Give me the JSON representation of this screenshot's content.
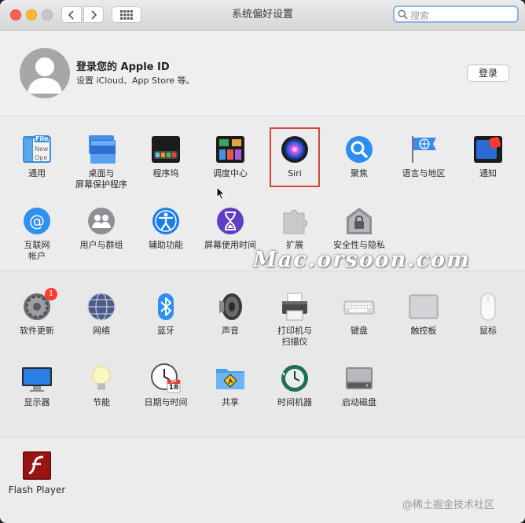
{
  "window": {
    "title": "系统偏好设置"
  },
  "search": {
    "placeholder": "搜索"
  },
  "account": {
    "title": "登录您的 Apple ID",
    "subtitle": "设置 iCloud、App Store 等。",
    "login_label": "登录"
  },
  "section1": [
    {
      "label": "通用",
      "icon": "general-icon"
    },
    {
      "label": "桌面与\n屏幕保护程序",
      "icon": "desktop-screensaver-icon"
    },
    {
      "label": "程序坞",
      "icon": "dock-icon"
    },
    {
      "label": "调度中心",
      "icon": "mission-control-icon"
    },
    {
      "label": "Siri",
      "icon": "siri-icon"
    },
    {
      "label": "聚焦",
      "icon": "spotlight-icon"
    },
    {
      "label": "语言与地区",
      "icon": "language-region-icon"
    },
    {
      "label": "通知",
      "icon": "notifications-icon"
    },
    {
      "label": "互联网\n帐户",
      "icon": "internet-accounts-icon"
    },
    {
      "label": "用户与群组",
      "icon": "users-groups-icon"
    },
    {
      "label": "辅助功能",
      "icon": "accessibility-icon"
    },
    {
      "label": "屏幕使用时间",
      "icon": "screen-time-icon"
    },
    {
      "label": "扩展",
      "icon": "extensions-icon"
    },
    {
      "label": "安全性与隐私",
      "icon": "security-privacy-icon"
    }
  ],
  "section2": [
    {
      "label": "软件更新",
      "icon": "software-update-icon",
      "badge": "1"
    },
    {
      "label": "网络",
      "icon": "network-icon"
    },
    {
      "label": "蓝牙",
      "icon": "bluetooth-icon"
    },
    {
      "label": "声音",
      "icon": "sound-icon"
    },
    {
      "label": "打印机与\n扫描仪",
      "icon": "printers-scanners-icon"
    },
    {
      "label": "键盘",
      "icon": "keyboard-icon"
    },
    {
      "label": "触控板",
      "icon": "trackpad-icon"
    },
    {
      "label": "鼠标",
      "icon": "mouse-icon"
    },
    {
      "label": "显示器",
      "icon": "displays-icon"
    },
    {
      "label": "节能",
      "icon": "energy-saver-icon"
    },
    {
      "label": "日期与时间",
      "icon": "date-time-icon",
      "calendar_month": "JUL",
      "calendar_day": "18"
    },
    {
      "label": "共享",
      "icon": "sharing-icon"
    },
    {
      "label": "时间机器",
      "icon": "time-machine-icon"
    },
    {
      "label": "启动磁盘",
      "icon": "startup-disk-icon"
    }
  ],
  "section3": [
    {
      "label": "Flash Player",
      "icon": "flash-player-icon"
    }
  ],
  "general_icon_text": [
    "File",
    "New",
    "Ope"
  ],
  "watermark": "Mac.orsoon.com",
  "footer_watermark": "@稀土掘金技术社区",
  "colors": {
    "highlight": "#d2453a",
    "badge": "#ff3b30",
    "search_focus": "#8fb3e8"
  }
}
